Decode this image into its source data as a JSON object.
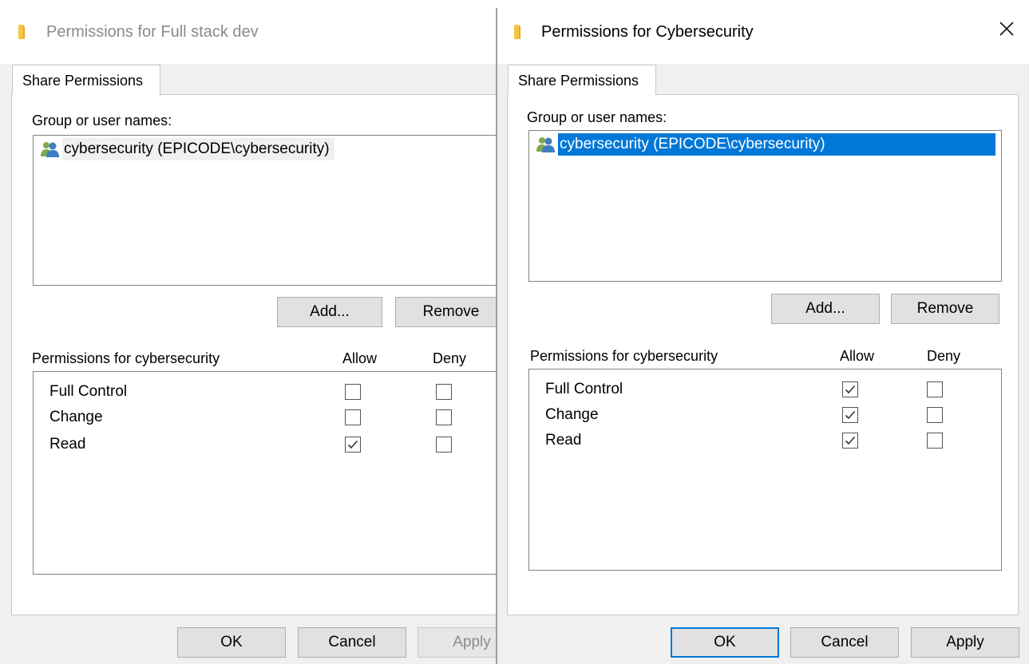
{
  "dialogs": [
    {
      "title": "Permissions for Full stack dev",
      "tab": "Share Permissions",
      "group_label": "Group or user names:",
      "users": [
        {
          "name": "cybersecurity (EPICODE\\cybersecurity)",
          "selected": true,
          "icon": "users-icon"
        }
      ],
      "add_label": "Add...",
      "remove_label": "Remove",
      "permissions_label": "Permissions for cybersecurity",
      "allow_label": "Allow",
      "deny_label": "Deny",
      "permissions": [
        {
          "name": "Full Control",
          "allow": false,
          "deny": false
        },
        {
          "name": "Change",
          "allow": false,
          "deny": false
        },
        {
          "name": "Read",
          "allow": true,
          "deny": false
        }
      ],
      "ok_label": "OK",
      "cancel_label": "Cancel",
      "apply_label": "Apply",
      "apply_enabled": false
    },
    {
      "title": "Permissions for Cybersecurity",
      "close_icon": "close-icon",
      "tab": "Share Permissions",
      "group_label": "Group or user names:",
      "users": [
        {
          "name": "cybersecurity (EPICODE\\cybersecurity)",
          "selected": true,
          "icon": "users-icon"
        }
      ],
      "add_label": "Add...",
      "remove_label": "Remove",
      "permissions_label": "Permissions for cybersecurity",
      "allow_label": "Allow",
      "deny_label": "Deny",
      "permissions": [
        {
          "name": "Full Control",
          "allow": true,
          "deny": false
        },
        {
          "name": "Change",
          "allow": true,
          "deny": false
        },
        {
          "name": "Read",
          "allow": true,
          "deny": false
        }
      ],
      "ok_label": "OK",
      "cancel_label": "Cancel",
      "apply_label": "Apply",
      "apply_enabled": true
    }
  ],
  "colors": {
    "dialog_bg": "#f0f0f0",
    "panel_bg": "#ffffff",
    "selection": "#0078d7",
    "button_bg": "#e1e1e1",
    "default_button_border": "#0078d7",
    "folder": "#f5c542"
  }
}
